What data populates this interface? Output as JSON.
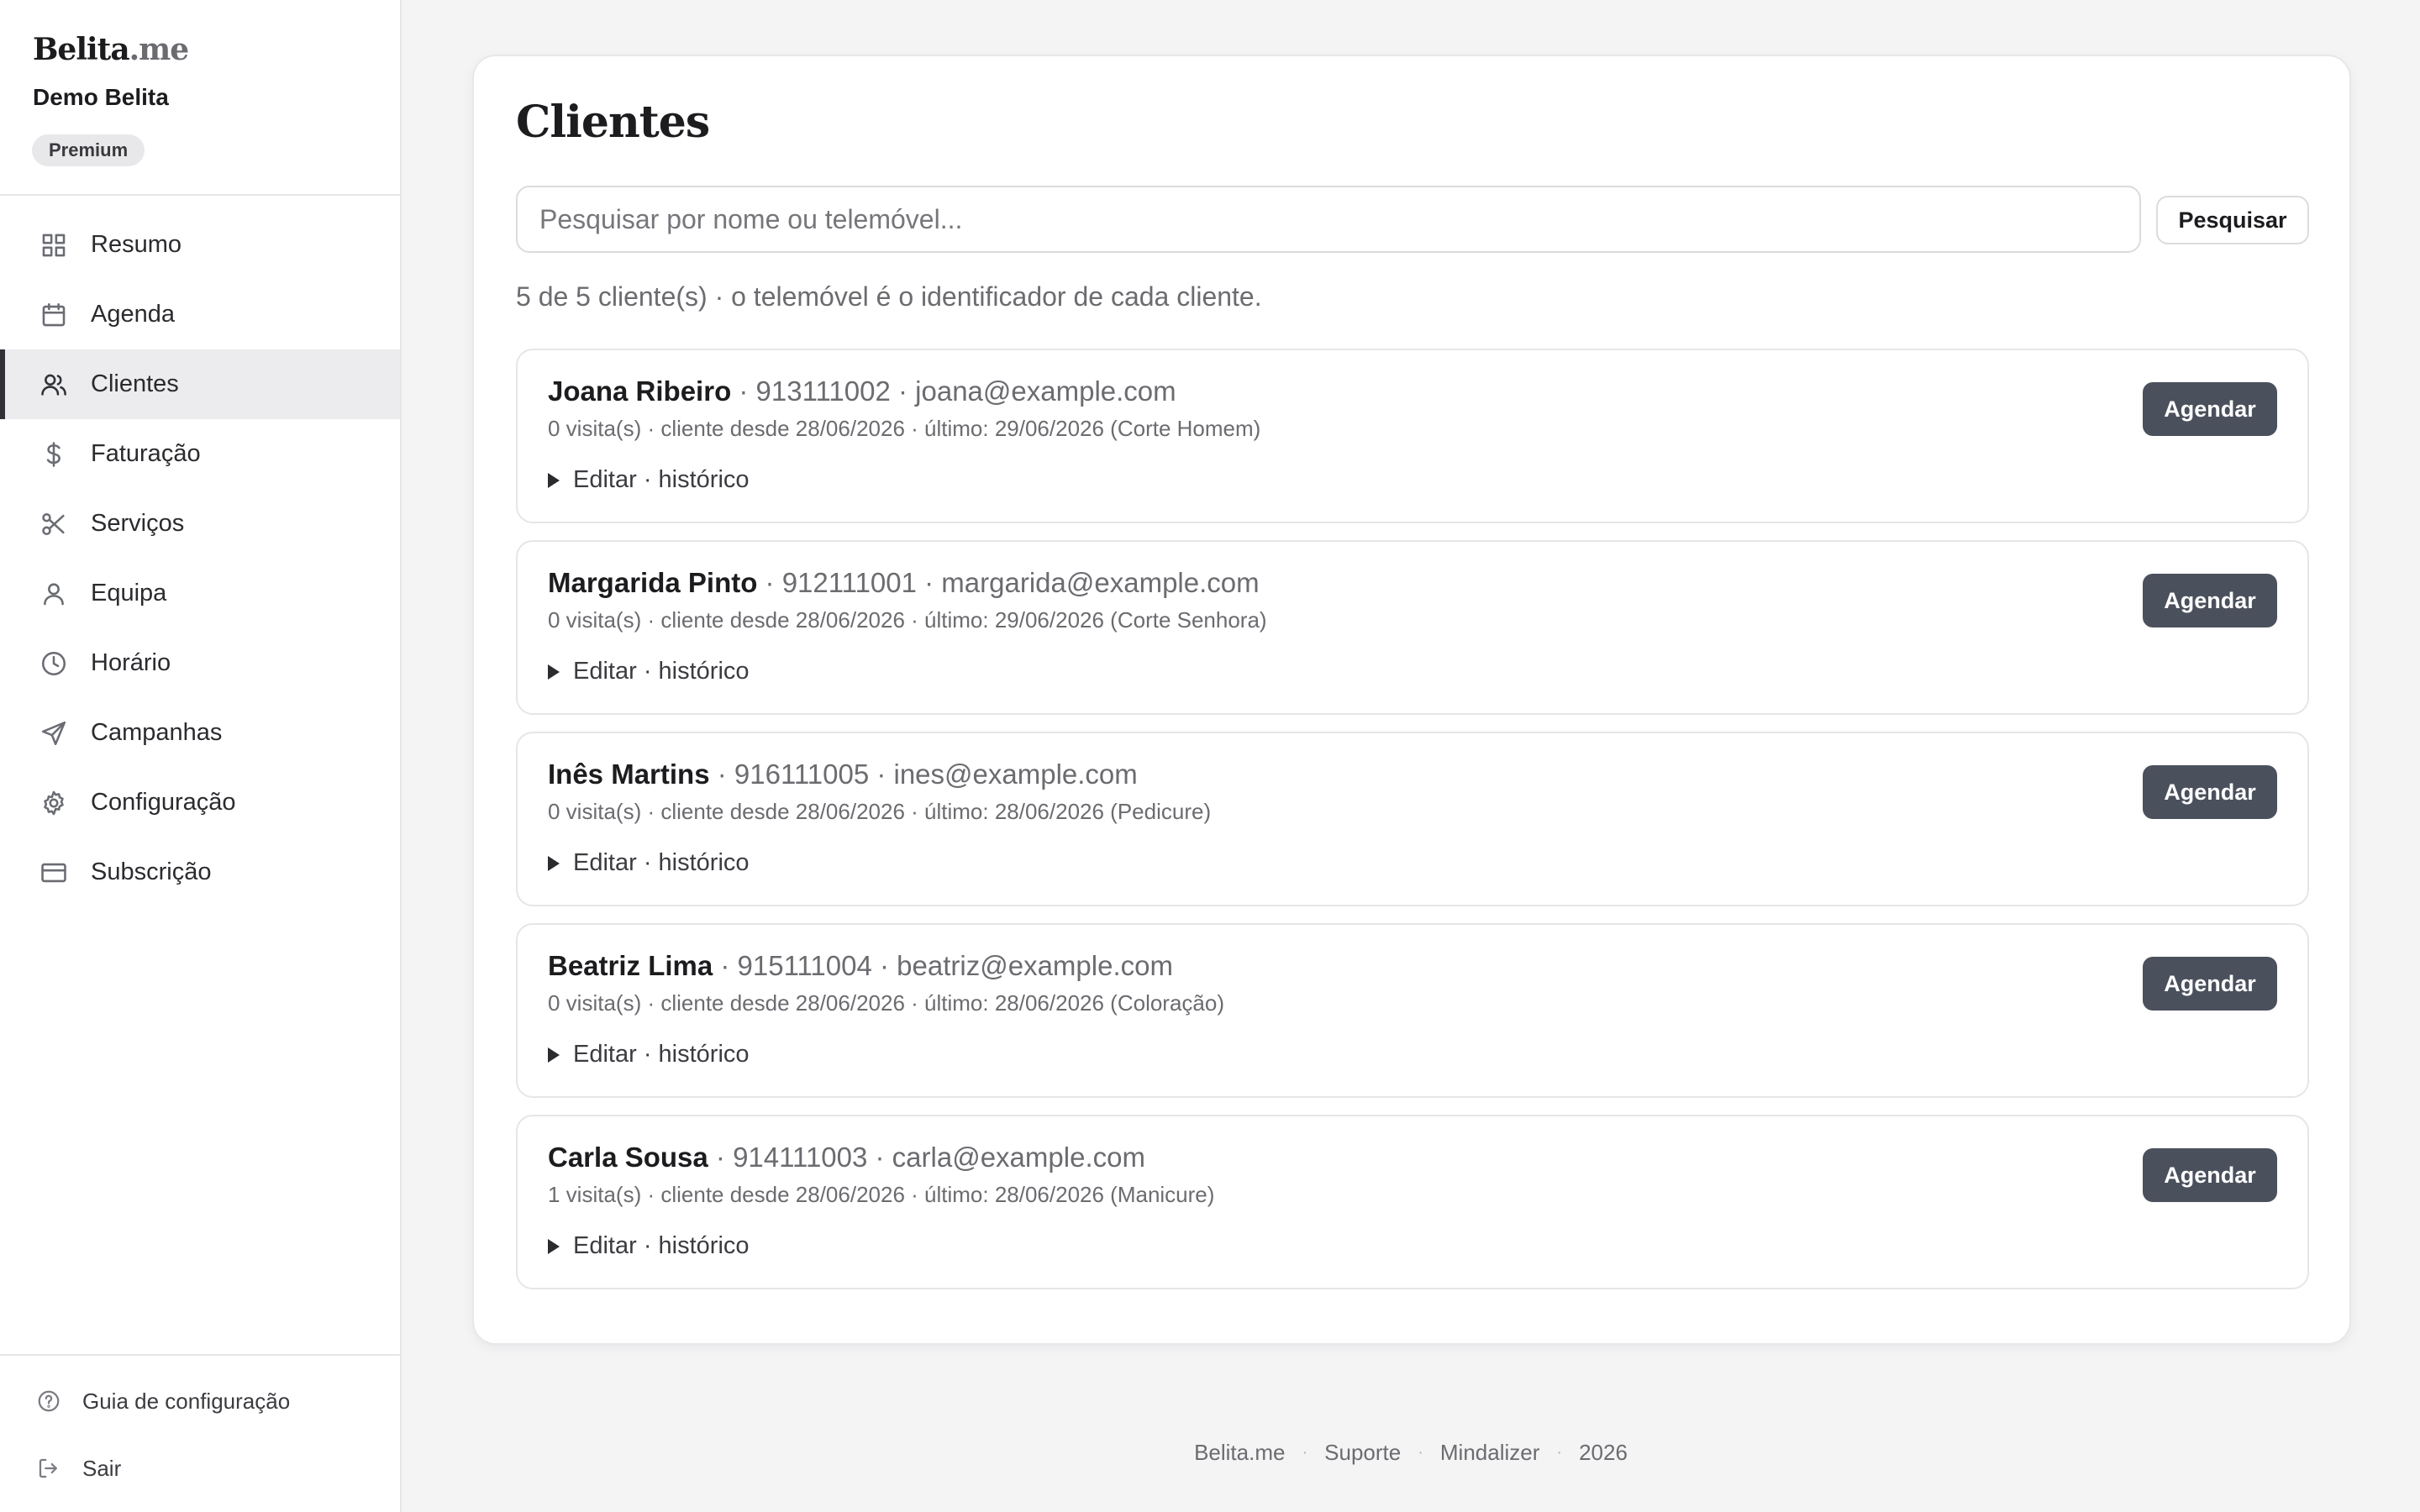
{
  "brand": {
    "name": "Belita",
    "tld": ".me"
  },
  "org": {
    "name": "Demo Belita",
    "plan": "Premium"
  },
  "nav": {
    "items": [
      {
        "label": "Resumo",
        "icon": "grid-icon"
      },
      {
        "label": "Agenda",
        "icon": "calendar-icon"
      },
      {
        "label": "Clientes",
        "icon": "users-icon",
        "active": true
      },
      {
        "label": "Faturação",
        "icon": "dollar-icon"
      },
      {
        "label": "Serviços",
        "icon": "scissors-icon"
      },
      {
        "label": "Equipa",
        "icon": "user-icon"
      },
      {
        "label": "Horário",
        "icon": "clock-icon"
      },
      {
        "label": "Campanhas",
        "icon": "send-icon"
      },
      {
        "label": "Configuração",
        "icon": "gear-icon"
      },
      {
        "label": "Subscrição",
        "icon": "credit-card-icon"
      }
    ],
    "bottom": [
      {
        "label": "Guia de configuração",
        "icon": "help-icon"
      },
      {
        "label": "Sair",
        "icon": "logout-icon"
      }
    ]
  },
  "main": {
    "title": "Clientes",
    "search": {
      "placeholder": "Pesquisar por nome ou telemóvel...",
      "value": "",
      "button_label": "Pesquisar"
    },
    "count_text": "5 de 5 cliente(s) · o telemóvel é o identificador de cada cliente.",
    "clients": [
      {
        "name": "Joana Ribeiro",
        "details": " · 913111002 · joana@example.com",
        "meta": "0 visita(s) · cliente desde 28/06/2026 · último: 29/06/2026 (Corte Homem)",
        "edit_label": "Editar · histórico",
        "action_label": "Agendar"
      },
      {
        "name": "Margarida Pinto",
        "details": " · 912111001 · margarida@example.com",
        "meta": "0 visita(s) · cliente desde 28/06/2026 · último: 29/06/2026 (Corte Senhora)",
        "edit_label": "Editar · histórico",
        "action_label": "Agendar"
      },
      {
        "name": "Inês Martins",
        "details": " · 916111005 · ines@example.com",
        "meta": "0 visita(s) · cliente desde 28/06/2026 · último: 28/06/2026 (Pedicure)",
        "edit_label": "Editar · histórico",
        "action_label": "Agendar"
      },
      {
        "name": "Beatriz Lima",
        "details": " · 915111004 · beatriz@example.com",
        "meta": "0 visita(s) · cliente desde 28/06/2026 · último: 28/06/2026 (Coloração)",
        "edit_label": "Editar · histórico",
        "action_label": "Agendar"
      },
      {
        "name": "Carla Sousa",
        "details": " · 914111003 · carla@example.com",
        "meta": "1 visita(s) · cliente desde 28/06/2026 · último: 28/06/2026 (Manicure)",
        "edit_label": "Editar · histórico",
        "action_label": "Agendar"
      }
    ]
  },
  "footer": {
    "links": [
      "Belita.me",
      "Suporte",
      "Mindalizer",
      "2026"
    ]
  },
  "colors": {
    "primary_button": "#4a505c",
    "background": "#f4f4f5",
    "active_nav": "#ececee"
  }
}
